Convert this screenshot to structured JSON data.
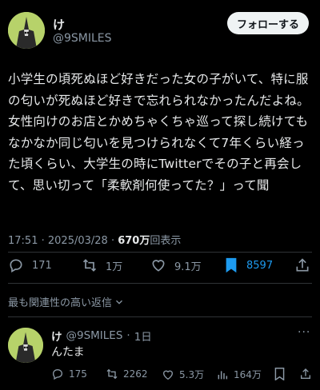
{
  "colors": {
    "background": "#000000",
    "text": "#e7e9ea",
    "muted": "#8b98a5",
    "accent": "#1d9bf0",
    "avatar": "#b7d26a"
  },
  "post": {
    "display_name": "け",
    "handle": "@9SMILES",
    "follow_label": "フォローする",
    "text": "小学生の頃死ぬほど好きだった女の子がいて、特に服の匂いが死ぬほど好きで忘れられなかったんだよね。女性向けのお店とかめちゃくちゃ巡って探し続けてもなかなか同じ匂いを見つけられなくて7年くらい経った頃くらい、大学生の時にTwitterでその子と再会して、思い切って「柔軟剤何使ってた？」って聞",
    "time": "17:51",
    "date": "2025/03/28",
    "views_count": "670万",
    "views_label": "回表示",
    "actions": {
      "replies": {
        "icon": "reply-icon",
        "count": "171"
      },
      "reposts": {
        "icon": "repost-icon",
        "count": "1万"
      },
      "likes": {
        "icon": "heart-icon",
        "count": "9.1万"
      },
      "bookmarks": {
        "icon": "bookmark-icon",
        "count": "8597"
      },
      "share": {
        "icon": "share-icon"
      }
    }
  },
  "replies_sort": {
    "label": "最も関連性の高い返信",
    "icon": "chevron-down-icon"
  },
  "reply": {
    "display_name": "け",
    "handle": "@9SMILES",
    "separator": "·",
    "time": "1日",
    "more": "···",
    "text": "んたま",
    "actions": {
      "replies": "175",
      "reposts": "2262",
      "likes": "5.3万",
      "views": "164万"
    }
  }
}
